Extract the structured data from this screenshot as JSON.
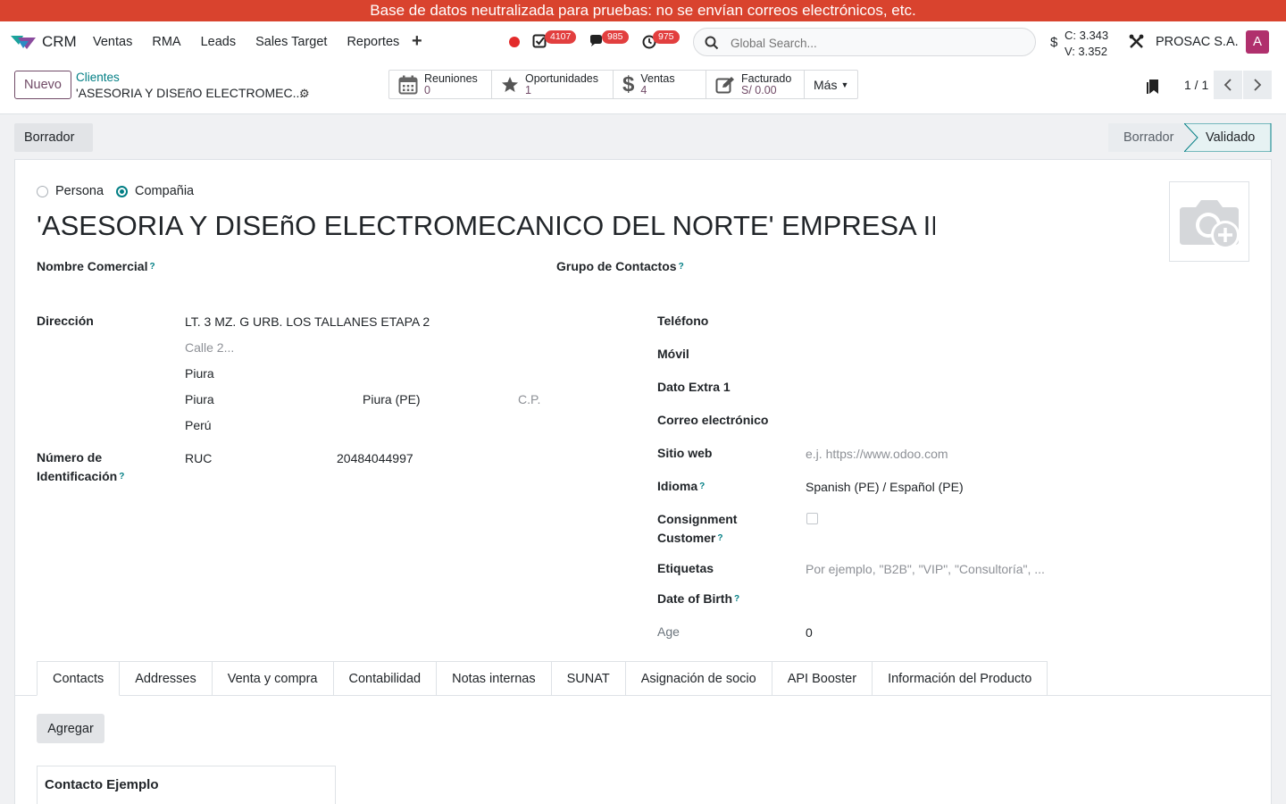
{
  "banner": {
    "text": "Base de datos neutralizada para pruebas: no se envían correos electrónicos, etc."
  },
  "navbar": {
    "app_name": "CRM",
    "menu": [
      "Ventas",
      "RMA",
      "Leads",
      "Sales Target",
      "Reportes"
    ],
    "badges": {
      "activities": "4107",
      "messages": "985",
      "timers": "975"
    },
    "search_placeholder": "Global Search...",
    "currency": {
      "symbol": "$",
      "buy": "C: 3.343",
      "sell": "V: 3.352"
    },
    "company": "PROSAC S.A.",
    "avatar_letter": "A",
    "icons": [
      "crm-logo-icon",
      "plus-icon",
      "record-dot-icon",
      "activity-check-icon",
      "chat-icon",
      "timer-icon",
      "search-icon",
      "dollar-icon",
      "tools-icon"
    ]
  },
  "control": {
    "new_label": "Nuevo",
    "breadcrumb": "Clientes",
    "current_record": "'ASESORIA Y DISEñO ELECTROMEC...",
    "smart_buttons": [
      {
        "label": "Reuniones",
        "value": "0",
        "icon": "calendar-icon"
      },
      {
        "label": "Oportunidades",
        "value": "1",
        "icon": "star-icon"
      },
      {
        "label": "Ventas",
        "value": "4",
        "icon": "dollar-icon"
      },
      {
        "label": "Facturado",
        "value": "S/ 0.00",
        "icon": "pencil-square-icon"
      }
    ],
    "more_label": "Más",
    "pager": "1 / 1"
  },
  "status": {
    "draft_button": "Borrador",
    "stages": [
      "Borrador",
      "Validado"
    ],
    "active_stage": "Validado"
  },
  "form": {
    "type_options": [
      "Persona",
      "Compañia"
    ],
    "selected_type": "Compañia",
    "name": "'ASESORIA Y DISEñO ELECTROMECANICO DEL NORTE' EMPRESA INDIVIDUAL DE RESPONSABILIDAD LIMITADA",
    "labels": {
      "commercial_name": "Nombre Comercial",
      "contact_group": "Grupo de Contactos",
      "address": "Dirección",
      "id_number_1": "Número de",
      "id_number_2": "Identificación",
      "phone": "Teléfono",
      "mobile": "Móvil",
      "extra": "Dato Extra 1",
      "email": "Correo electrónico",
      "website": "Sitio web",
      "language": "Idioma",
      "consignment_1": "Consignment",
      "consignment_2": "Customer",
      "tags": "Etiquetas",
      "birth": "Date of Birth",
      "age": "Age"
    },
    "address": {
      "street": "LT. 3 MZ. G URB. LOS TALLANES ETAPA 2",
      "street2_placeholder": "Calle 2...",
      "city": "Piura",
      "district": "Piura",
      "state": "Piura (PE)",
      "zip_placeholder": "C.P.",
      "country": "Perú"
    },
    "id_type": "RUC",
    "id_value": "20484044997",
    "website_placeholder": "e.j. https://www.odoo.com",
    "language_value": "Spanish (PE) / Español (PE)",
    "consignment_checked": false,
    "tags_placeholder": "Por ejemplo, \"B2B\", \"VIP\", \"Consultoría\", ...",
    "age_value": "0",
    "help_mark": "?"
  },
  "tabs": [
    "Contacts",
    "Addresses",
    "Venta y compra",
    "Contabilidad",
    "Notas internas",
    "SUNAT",
    "Asignación de socio",
    "API Booster",
    "Información del Producto"
  ],
  "contacts": {
    "add_label": "Agregar",
    "card_title": "Contacto Ejemplo"
  },
  "colors": {
    "banner": "#d9432e",
    "primary": "#714b67",
    "link": "#017e84",
    "badge": "#e23f3f",
    "avatar": "#b0306d"
  }
}
